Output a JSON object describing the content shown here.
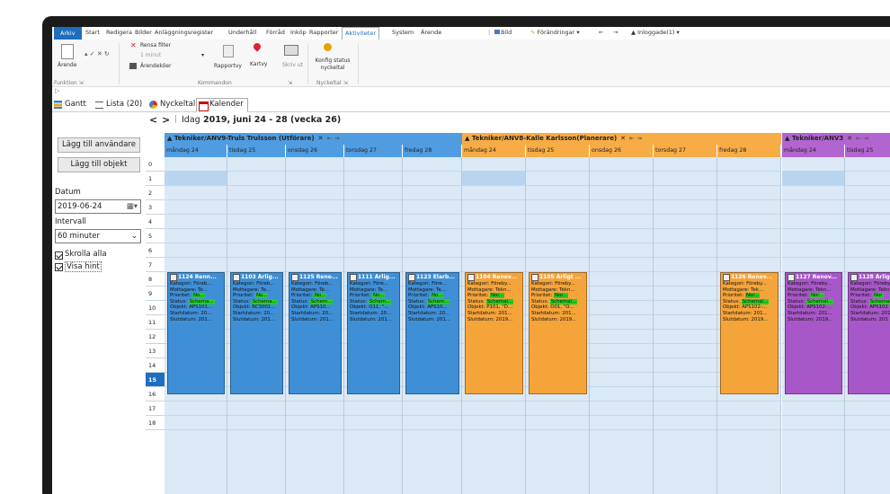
{
  "menu": {
    "items": [
      "Arkiv",
      "Start",
      "Redigera",
      "Bilder",
      "Anläggningsregister",
      "Underhåll",
      "Förråd",
      "Inköp",
      "Rapporter",
      "Aktiviteter",
      "System",
      "Ärende"
    ],
    "right": {
      "image_label": "Bild",
      "changes_label": "Förändringar",
      "logged_in": "Inloggade(1)"
    }
  },
  "ribbon": {
    "arende": "Ärende",
    "rensa_filter": "Rensa filter",
    "one_minute": "1 minut",
    "arendekoer": "Ärendeköer",
    "rapportvy": "Rapportvy",
    "kartvy": "Kartvy",
    "skriv_ut": "Skriv ut",
    "konfig": "Konfig status nyckeltal",
    "grp_funktion": "Funktion",
    "grp_kommandon": "Kommandon",
    "grp_nyckeltal": "Nyckeltal"
  },
  "tabs": [
    {
      "label": "Gantt"
    },
    {
      "label": "Lista (20)"
    },
    {
      "label": "Nyckeltal"
    },
    {
      "label": "Kalender"
    }
  ],
  "sidebar": {
    "add_user": "Lägg till användare",
    "add_object": "Lägg till objekt",
    "datum_label": "Datum",
    "datum_value": "2019-06-24",
    "intervall_label": "Intervall",
    "intervall_value": "60 minuter",
    "scroll_all": "Skrolla alla",
    "show_hint": "Visa hint"
  },
  "nav": {
    "today": "Idag",
    "range": "2019, juni 24 - 28 (vecka 26)"
  },
  "hours": [
    "0",
    "1",
    "2",
    "3",
    "4",
    "5",
    "6",
    "7",
    "8",
    "9",
    "10",
    "11",
    "12",
    "13",
    "14",
    "15",
    "16",
    "17",
    "18"
  ],
  "current_hour": "15",
  "resources": [
    {
      "name": "Tekniker/ANV9-Truls Trulsson (Utförare)",
      "color": "#3f8fd6",
      "hdr": "#4f9de0",
      "slot": "#d6e6f6",
      "days": [
        "måndag 24",
        "tisdag 25",
        "onsdag 26",
        "torsdag 27",
        "fredag 28"
      ]
    },
    {
      "name": "Tekniker/ANV8-Kalle Karlsson(Planerare)",
      "color": "#f5a43a",
      "hdr": "#f7ac45",
      "slot": "#d6e6f6",
      "days": [
        "måndag 24",
        "tisdag 25",
        "onsdag 26",
        "torsdag 27",
        "fredag 28"
      ]
    },
    {
      "name": "Tekniker/ANV3",
      "color": "#a857c8",
      "hdr": "#b264d0",
      "slot": "#d6e6f6",
      "days": [
        "måndag 24",
        "tisdag 25"
      ]
    }
  ],
  "appointments": [
    {
      "res": 0,
      "day": 0,
      "title": "1124 Renn...",
      "kat": "Kategori: Föreb...",
      "mot": "Mottagare: Te...",
      "pri": "Prioritet: ",
      "pri_v": "No...",
      "stat": "Status: ",
      "stat_v": "Schema...",
      "obj": "Objekt: APS101...",
      "start": "Startdatum: 20...",
      "slut": "Slutdatum: 201..."
    },
    {
      "res": 0,
      "day": 1,
      "title": "1103 Årlig...",
      "kat": "Kategori: Föreb...",
      "mot": "Mottagare: Te...",
      "pri": "Prioritet: ",
      "pri_v": "No...",
      "stat": "Status: ",
      "stat_v": "Schema...",
      "obj": "Objekt: RC3001...",
      "start": "Startdatum: 20...",
      "slut": "Slutdatum: 201..."
    },
    {
      "res": 0,
      "day": 2,
      "title": "1125 Reno...",
      "kat": "Kategori: Föreb...",
      "mot": "Mottagare: Te...",
      "pri": "Prioritet: ",
      "pri_v": "No...",
      "stat": "Status: ",
      "stat_v": "Schem...",
      "obj": "Objekt: APS10...",
      "start": "Startdatum: 20...",
      "slut": "Slutdatum: 201..."
    },
    {
      "res": 0,
      "day": 3,
      "title": "1111 Årlig...",
      "kat": "Kategori: Före...",
      "mot": "Mottagare: Te...",
      "pri": "Prioritet: ",
      "pri_v": "No...",
      "stat": "Status: ",
      "stat_v": "Schem...",
      "obj": "Objekt: O11, \"...",
      "start": "Startdatum: 20...",
      "slut": "Slutdatum: 201..."
    },
    {
      "res": 0,
      "day": 4,
      "title": "1123 Elarb...",
      "kat": "Kategori: Före...",
      "mot": "Mottagare: Te...",
      "pri": "Prioritet: ",
      "pri_v": "No...",
      "stat": "Status: ",
      "stat_v": "Schem...",
      "obj": "Objekt: APS10...",
      "start": "Startdatum: 20...",
      "slut": "Slutdatum: 201..."
    },
    {
      "res": 1,
      "day": 0,
      "title": "1104 Renov...",
      "kat": "Kategori: Föreby...",
      "mot": "Mottagare: Tekn...",
      "pri": "Prioritet: ",
      "pri_v": "Nor...",
      "stat": "Status: ",
      "stat_v": "Schemal...",
      "obj": "Objekt: P101, \"D...",
      "start": "Startdatum: 201...",
      "slut": "Slutdatum: 2019..."
    },
    {
      "res": 1,
      "day": 1,
      "title": "1105 Årligt ...",
      "kat": "Kategori: Föreby...",
      "mot": "Mottagare: Tekn...",
      "pri": "Prioritet: ",
      "pri_v": "Nor...",
      "stat": "Status: ",
      "stat_v": "Schemal...",
      "obj": "Objekt: O01, \"O...",
      "start": "Startdatum: 201...",
      "slut": "Slutdatum: 2019..."
    },
    {
      "res": 1,
      "day": 4,
      "title": "1126 Renov...",
      "kat": "Kategori: Föreby...",
      "mot": "Mottagare: Tek...",
      "pri": "Prioritet: ",
      "pri_v": "Nor...",
      "stat": "Status: ",
      "stat_v": "Schemal...",
      "obj": "Objekt: APS102-...",
      "start": "Startdatum: 201...",
      "slut": "Slutdatum: 2019..."
    },
    {
      "res": 2,
      "day": 0,
      "title": "1127 Renov...",
      "kat": "Kategori: Föreby...",
      "mot": "Mottagare: Tekn...",
      "pri": "Prioritet: ",
      "pri_v": "Nor...",
      "stat": "Status: ",
      "stat_v": "Schemal...",
      "obj": "Objekt: APS102-...",
      "start": "Startdatum: 201...",
      "slut": "Slutdatum: 2019..."
    },
    {
      "res": 2,
      "day": 1,
      "title": "1128 Årligt",
      "kat": "Kategori: Föreby",
      "mot": "Mottagare: Tekn",
      "pri": "Prioritet: ",
      "pri_v": "Nor",
      "stat": "Status: ",
      "stat_v": "Schemal",
      "obj": "Objekt: APS102",
      "start": "Startdatum: 201",
      "slut": "Slutdatum: 201"
    }
  ]
}
